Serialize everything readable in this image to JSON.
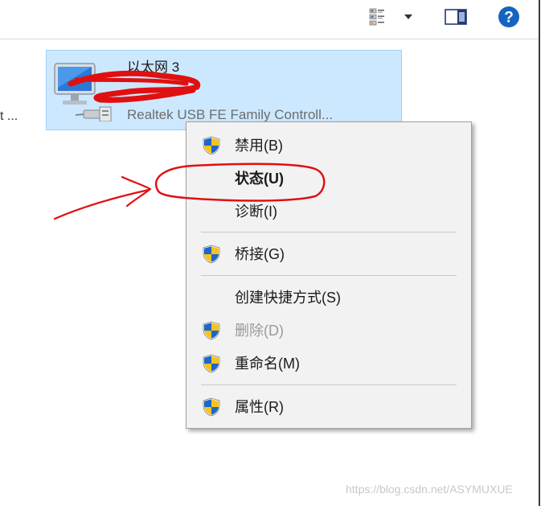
{
  "toolbar": {
    "icons": [
      "view-options-icon",
      "dropdown-arrow-icon",
      "preview-pane-icon",
      "help-icon"
    ],
    "help_glyph": "?"
  },
  "left_item": {
    "truncated_text": "t ..."
  },
  "adapter": {
    "name": "以太网 3",
    "device": "Realtek USB FE Family Controll..."
  },
  "context_menu": {
    "items": [
      {
        "label": "禁用(B)",
        "icon": "shield-icon"
      },
      {
        "label": "状态(U)",
        "icon": ""
      },
      {
        "label": "诊断(I)",
        "icon": ""
      },
      {
        "label": "桥接(G)",
        "icon": "shield-icon"
      },
      {
        "label": "创建快捷方式(S)",
        "icon": ""
      },
      {
        "label": "删除(D)",
        "icon": "shield-icon"
      },
      {
        "label": "重命名(M)",
        "icon": "shield-icon"
      },
      {
        "label": "属性(R)",
        "icon": "shield-icon"
      }
    ]
  },
  "watermark": "https://blog.csdn.net/ASYMUXUE",
  "colors": {
    "selection_bg": "#cce8ff",
    "selection_border": "#99d1ff",
    "menu_bg": "#f2f2f2",
    "annotation_red": "#e01010",
    "help_blue": "#1565c0"
  }
}
